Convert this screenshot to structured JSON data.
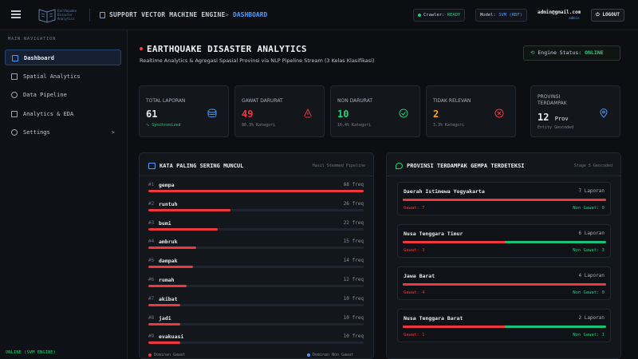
{
  "topbar": {
    "logo_text": "Earthquake Disaster Analytics",
    "app_name": "SUPPORT VECTOR MACHINE ENGINE",
    "crumb_sep": ">",
    "page": "DASHBOARD",
    "crawler_label": "Crawler:",
    "crawler_value": "READY",
    "model_label": "Model:",
    "model_value": "SVM (RBF)",
    "user_email": "admin@gmail.com",
    "user_role": "admin",
    "logout_label": "LOGOUT"
  },
  "sidebar": {
    "title": "MAIN NAVIGATION",
    "items": [
      {
        "label": "Dashboard",
        "icon": "grid-icon",
        "active": true
      },
      {
        "label": "Spatial Analytics",
        "icon": "map-icon",
        "active": false
      },
      {
        "label": "Data Pipeline",
        "icon": "pipeline-icon",
        "active": false
      },
      {
        "label": "Analytics & EDA",
        "icon": "chart-icon",
        "active": false
      },
      {
        "label": "Settings",
        "icon": "gear-icon",
        "active": false,
        "chevron": ">"
      }
    ],
    "engine_status": "ONLINE (SVM ENGINE)"
  },
  "header": {
    "title": "EARTHQUAKE DISASTER ANALYTICS",
    "subtitle": "Realtime Analytics & Agregasi Spasial Provinsi via NLP Pipeline Stream (3 Kelas Klasifikasi)",
    "engine_label": "Engine Status:",
    "engine_value": "ONLINE"
  },
  "cards": [
    {
      "title": "TOTAL LAPORAN",
      "value": "61",
      "sub": "Synchronized",
      "color": "#e6e9ee",
      "icon": "database-icon",
      "icon_color": "#4b9bff"
    },
    {
      "title": "GAWAT DARURAT",
      "value": "49",
      "sub": "80.3% Kategori",
      "color": "#f0363f",
      "icon": "warning-icon",
      "icon_color": "#f0363f"
    },
    {
      "title": "NON DARURAT",
      "value": "10",
      "sub": "16.4% Kategori",
      "color": "#22d27a",
      "icon": "check-icon",
      "icon_color": "#22d27a"
    },
    {
      "title": "TIDAK RELEVAN",
      "value": "2",
      "sub": "3.3% Kategori",
      "color": "#f5a623",
      "icon": "close-circle-icon",
      "icon_color": "#f0363f"
    },
    {
      "title": "PROVINSI TERDAMPAK",
      "value": "12",
      "unit": "Prov",
      "sub": "Entity Geocoded",
      "color": "#e6e9ee",
      "icon": "pin-icon",
      "icon_color": "#4b9bff"
    }
  ],
  "words_panel": {
    "title": "KATA PALING SERING MUNCUL",
    "meta": "Hasil Stemmed Pipeline",
    "unit": "freq",
    "max": 68,
    "items": [
      {
        "rank": "#1",
        "word": "gempa",
        "count": 68
      },
      {
        "rank": "#2",
        "word": "runtuh",
        "count": 26
      },
      {
        "rank": "#3",
        "word": "bumi",
        "count": 22
      },
      {
        "rank": "#4",
        "word": "ambruk",
        "count": 15
      },
      {
        "rank": "#5",
        "word": "dampak",
        "count": 14
      },
      {
        "rank": "#6",
        "word": "rumah",
        "count": 12
      },
      {
        "rank": "#7",
        "word": "akibat",
        "count": 10
      },
      {
        "rank": "#8",
        "word": "jadi",
        "count": 10
      },
      {
        "rank": "#9",
        "word": "evakuasi",
        "count": 10
      }
    ],
    "legend_gawat": "Dominan Gawat",
    "legend_non": "Dominan Non Gawat"
  },
  "prov_panel": {
    "title": "PROVINSI TERDAMPAK GEMPA TERDETEKSI",
    "meta": "Stage 5 Geocoded",
    "items": [
      {
        "name": "Daerah Istimewa Yogyakarta",
        "reports": "7 Laporan",
        "gawat": "Gawat: 7",
        "non": "Non Gawat: 0",
        "ratio": 1.0
      },
      {
        "name": "Nusa Tenggara Timur",
        "reports": "6 Laporan",
        "gawat": "Gawat: 3",
        "non": "Non Gawat: 3",
        "ratio": 0.5
      },
      {
        "name": "Jawa Barat",
        "reports": "4 Laporan",
        "gawat": "Gawat: 4",
        "non": "Non Gawat: 0",
        "ratio": 1.0
      },
      {
        "name": "Nusa Tenggara Barat",
        "reports": "2 Laporan",
        "gawat": "Gawat: 1",
        "non": "Non Gawat: 1",
        "ratio": 0.5
      }
    ]
  },
  "colors": {
    "accent": "#4b9bff",
    "danger": "#f0363f",
    "success": "#22d27a",
    "warning": "#f5a623"
  }
}
